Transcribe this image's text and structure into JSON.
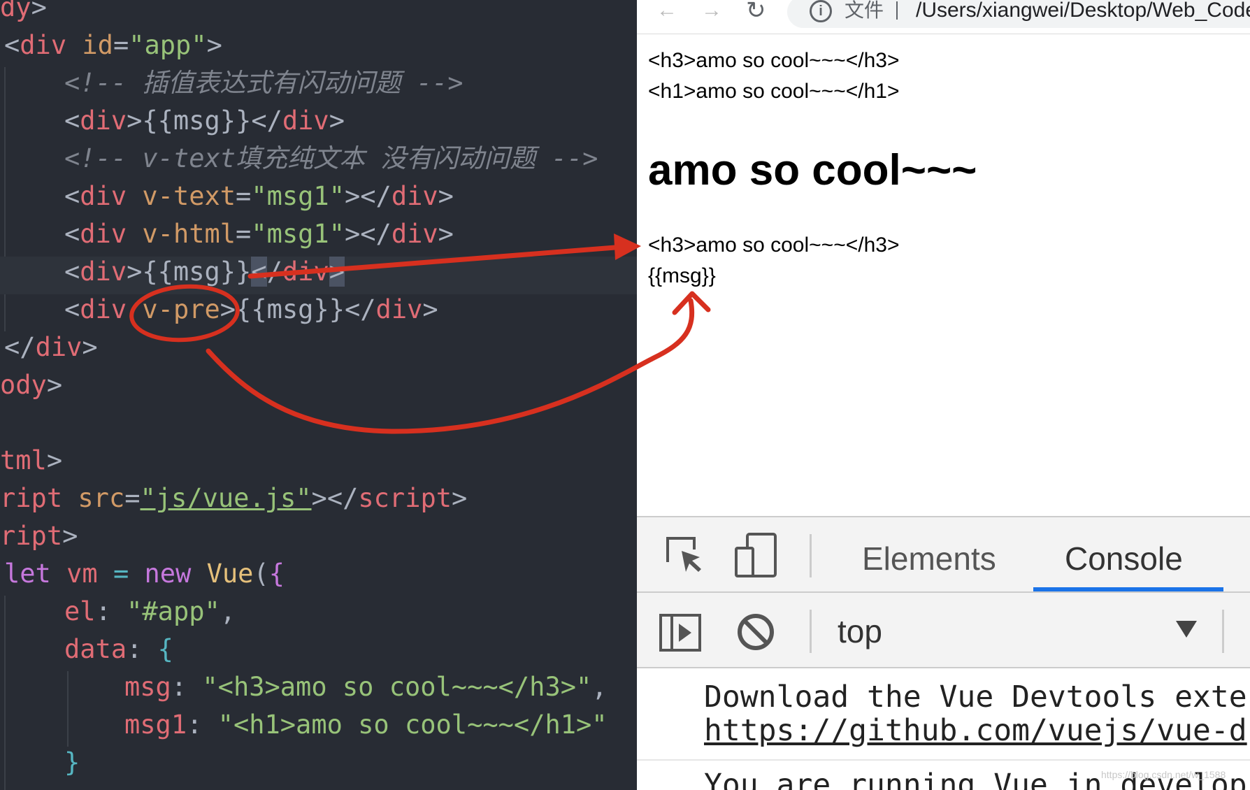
{
  "editor": {
    "lines": [
      {
        "tokens": [
          {
            "cls": "t",
            "text": "dy"
          },
          {
            "cls": "p",
            "text": ">"
          }
        ]
      },
      {
        "tokens": [
          {
            "cls": "p",
            "text": "<"
          },
          {
            "cls": "t",
            "text": "div"
          },
          {
            "cls": "p",
            "text": " "
          },
          {
            "cls": "a",
            "text": "id"
          },
          {
            "cls": "p",
            "text": "="
          },
          {
            "cls": "s",
            "text": "\"app\""
          },
          {
            "cls": "p",
            "text": ">"
          }
        ]
      },
      {
        "tokens": [
          {
            "cls": "c",
            "text": "<!-- 插值表达式有闪动问题 -->"
          }
        ]
      },
      {
        "tokens": [
          {
            "cls": "p",
            "text": "<"
          },
          {
            "cls": "t",
            "text": "div"
          },
          {
            "cls": "p",
            "text": ">{{msg}}</"
          },
          {
            "cls": "t",
            "text": "div"
          },
          {
            "cls": "p",
            "text": ">"
          }
        ]
      },
      {
        "tokens": [
          {
            "cls": "c",
            "text": "<!-- v-text填充纯文本 没有闪动问题 -->"
          }
        ]
      },
      {
        "tokens": [
          {
            "cls": "p",
            "text": "<"
          },
          {
            "cls": "t",
            "text": "div"
          },
          {
            "cls": "p",
            "text": " "
          },
          {
            "cls": "a",
            "text": "v-text"
          },
          {
            "cls": "p",
            "text": "="
          },
          {
            "cls": "s",
            "text": "\"msg1\""
          },
          {
            "cls": "p",
            "text": "></"
          },
          {
            "cls": "t",
            "text": "div"
          },
          {
            "cls": "p",
            "text": ">"
          }
        ]
      },
      {
        "tokens": [
          {
            "cls": "p",
            "text": "<"
          },
          {
            "cls": "t",
            "text": "div"
          },
          {
            "cls": "p",
            "text": " "
          },
          {
            "cls": "a",
            "text": "v-html"
          },
          {
            "cls": "p",
            "text": "="
          },
          {
            "cls": "s",
            "text": "\"msg1\""
          },
          {
            "cls": "p",
            "text": "></"
          },
          {
            "cls": "t",
            "text": "div"
          },
          {
            "cls": "p",
            "text": ">"
          }
        ]
      },
      {
        "tokens": [
          {
            "cls": "p",
            "text": "<"
          },
          {
            "cls": "t",
            "text": "div"
          },
          {
            "cls": "p",
            "text": ">{{msg}}"
          },
          {
            "cls": "p hl",
            "text": "<"
          },
          {
            "cls": "p",
            "text": "/"
          },
          {
            "cls": "t",
            "text": "div"
          },
          {
            "cls": "p hl",
            "text": ">"
          }
        ]
      },
      {
        "tokens": [
          {
            "cls": "p",
            "text": "<"
          },
          {
            "cls": "t",
            "text": "div"
          },
          {
            "cls": "p",
            "text": " "
          },
          {
            "cls": "a",
            "text": "v-pre"
          },
          {
            "cls": "p",
            "text": ">{{msg}}</"
          },
          {
            "cls": "t",
            "text": "div"
          },
          {
            "cls": "p",
            "text": ">"
          }
        ]
      },
      {
        "tokens": [
          {
            "cls": "p",
            "text": "</"
          },
          {
            "cls": "t",
            "text": "div"
          },
          {
            "cls": "p",
            "text": ">"
          }
        ]
      },
      {
        "tokens": [
          {
            "cls": "t",
            "text": "ody"
          },
          {
            "cls": "p",
            "text": ">"
          }
        ]
      },
      {
        "tokens": []
      },
      {
        "tokens": [
          {
            "cls": "t",
            "text": "tml"
          },
          {
            "cls": "p",
            "text": ">"
          }
        ]
      },
      {
        "tokens": [
          {
            "cls": "t",
            "text": "ript"
          },
          {
            "cls": "p",
            "text": " "
          },
          {
            "cls": "a",
            "text": "src"
          },
          {
            "cls": "p",
            "text": "="
          },
          {
            "cls": "s u",
            "text": "\"js/vue.js\""
          },
          {
            "cls": "p",
            "text": "></"
          },
          {
            "cls": "t",
            "text": "script"
          },
          {
            "cls": "p",
            "text": ">"
          }
        ]
      },
      {
        "tokens": [
          {
            "cls": "t",
            "text": "ript"
          },
          {
            "cls": "p",
            "text": ">"
          }
        ]
      },
      {
        "tokens": [
          {
            "cls": "k",
            "text": "let"
          },
          {
            "cls": "p",
            "text": " "
          },
          {
            "cls": "t",
            "text": "vm"
          },
          {
            "cls": "p",
            "text": " "
          },
          {
            "cls": "b",
            "text": "="
          },
          {
            "cls": "p",
            "text": " "
          },
          {
            "cls": "k",
            "text": "new"
          },
          {
            "cls": "p",
            "text": " "
          },
          {
            "cls": "cls",
            "text": "Vue"
          },
          {
            "cls": "p",
            "text": "("
          },
          {
            "cls": "k",
            "text": "{"
          }
        ]
      },
      {
        "tokens": [
          {
            "cls": "t",
            "text": "el"
          },
          {
            "cls": "p",
            "text": ": "
          },
          {
            "cls": "s",
            "text": "\"#app\""
          },
          {
            "cls": "p",
            "text": ","
          }
        ]
      },
      {
        "tokens": [
          {
            "cls": "t",
            "text": "data"
          },
          {
            "cls": "p",
            "text": ": "
          },
          {
            "cls": "b",
            "text": "{"
          }
        ]
      },
      {
        "tokens": [
          {
            "cls": "t",
            "text": "msg"
          },
          {
            "cls": "p",
            "text": ": "
          },
          {
            "cls": "s",
            "text": "\"<h3>amo so cool~~~</h3>\""
          },
          {
            "cls": "p",
            "text": ","
          }
        ]
      },
      {
        "tokens": [
          {
            "cls": "t",
            "text": "msg1"
          },
          {
            "cls": "p",
            "text": ": "
          },
          {
            "cls": "s",
            "text": "\"<h1>amo so cool~~~</h1>\""
          }
        ]
      },
      {
        "tokens": [
          {
            "cls": "b",
            "text": "}"
          }
        ]
      }
    ]
  },
  "browser": {
    "back_arrow": "←",
    "forward_arrow": "→",
    "reload_glyph": "↻",
    "info_glyph": "i",
    "protocol_label": "文件",
    "url": "/Users/xiangwei/Desktop/Web_Code/V",
    "page": {
      "line1": "<h3>amo so cool~~~</h3>",
      "line2": "<h1>amo so cool~~~</h1>",
      "heading": "amo so cool~~~",
      "line4": "<h3>amo so cool~~~</h3>",
      "line5": "{{msg}}"
    }
  },
  "devtools": {
    "tab_elements": "Elements",
    "tab_console": "Console",
    "context": "top",
    "console_lines": [
      "Download the Vue Devtools exte",
      "https://github.com/vuejs/vue-d",
      "You are running Vue in develop"
    ]
  },
  "watermark": "https://blog.csdn.net/w_1588",
  "colors": {
    "annotation": "#d7301f",
    "accent_tab": "#1a73e8",
    "editor_bg": "#282c34"
  }
}
